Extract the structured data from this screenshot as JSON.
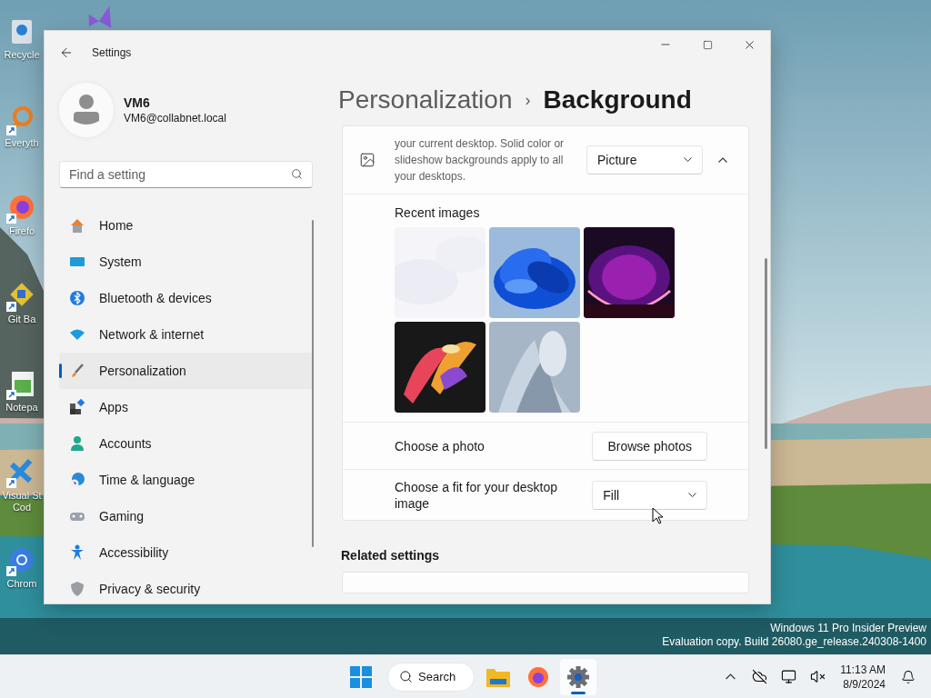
{
  "desktop_icons": [
    {
      "label": "Recycle",
      "kind": "recycle",
      "shortcut": false
    },
    {
      "label": "Everyth",
      "kind": "everything",
      "shortcut": true
    },
    {
      "label": "Firefo",
      "kind": "firefox",
      "shortcut": true
    },
    {
      "label": "Git Ba",
      "kind": "git",
      "shortcut": true
    },
    {
      "label": "Notepa",
      "kind": "notepad",
      "shortcut": true
    },
    {
      "label": "Visual St\nCod",
      "kind": "vscode",
      "shortcut": true
    },
    {
      "label": "Chrom",
      "kind": "chrome",
      "shortcut": true
    }
  ],
  "desktop_icons_top": [
    {
      "kind": "vs"
    }
  ],
  "window": {
    "title": "Settings"
  },
  "profile": {
    "name": "VM6",
    "email": "VM6@collabnet.local"
  },
  "search": {
    "placeholder": "Find a setting"
  },
  "nav": [
    {
      "label": "Home",
      "selected": false
    },
    {
      "label": "System",
      "selected": false
    },
    {
      "label": "Bluetooth & devices",
      "selected": false
    },
    {
      "label": "Network & internet",
      "selected": false
    },
    {
      "label": "Personalization",
      "selected": true
    },
    {
      "label": "Apps",
      "selected": false
    },
    {
      "label": "Accounts",
      "selected": false
    },
    {
      "label": "Time & language",
      "selected": false
    },
    {
      "label": "Gaming",
      "selected": false
    },
    {
      "label": "Accessibility",
      "selected": false
    },
    {
      "label": "Privacy & security",
      "selected": false
    }
  ],
  "breadcrumb": {
    "parent": "Personalization",
    "separator": "›",
    "current": "Background"
  },
  "background_row": {
    "description": "your current desktop. Solid color or slideshow backgrounds apply to all your desktops.",
    "dropdown": "Picture",
    "expanded": true
  },
  "recent_images": {
    "label": "Recent images"
  },
  "choose_photo": {
    "label": "Choose a photo",
    "button": "Browse photos"
  },
  "fit": {
    "label": "Choose a fit for your desktop image",
    "value": "Fill"
  },
  "related": {
    "heading": "Related settings"
  },
  "build_info": [
    "Windows 11 Pro Insider Preview",
    "Evaluation copy. Build 26080.ge_release.240308-1400"
  ],
  "taskbar": {
    "apps": [
      {
        "kind": "start",
        "selected": false
      },
      {
        "kind": "search",
        "label": "Search",
        "selected": false
      },
      {
        "kind": "explorer",
        "selected": false
      },
      {
        "kind": "firefox",
        "selected": false
      },
      {
        "kind": "settings",
        "selected": true
      }
    ],
    "clock": {
      "time": "11:13 AM",
      "date": "8/9/2024"
    }
  }
}
